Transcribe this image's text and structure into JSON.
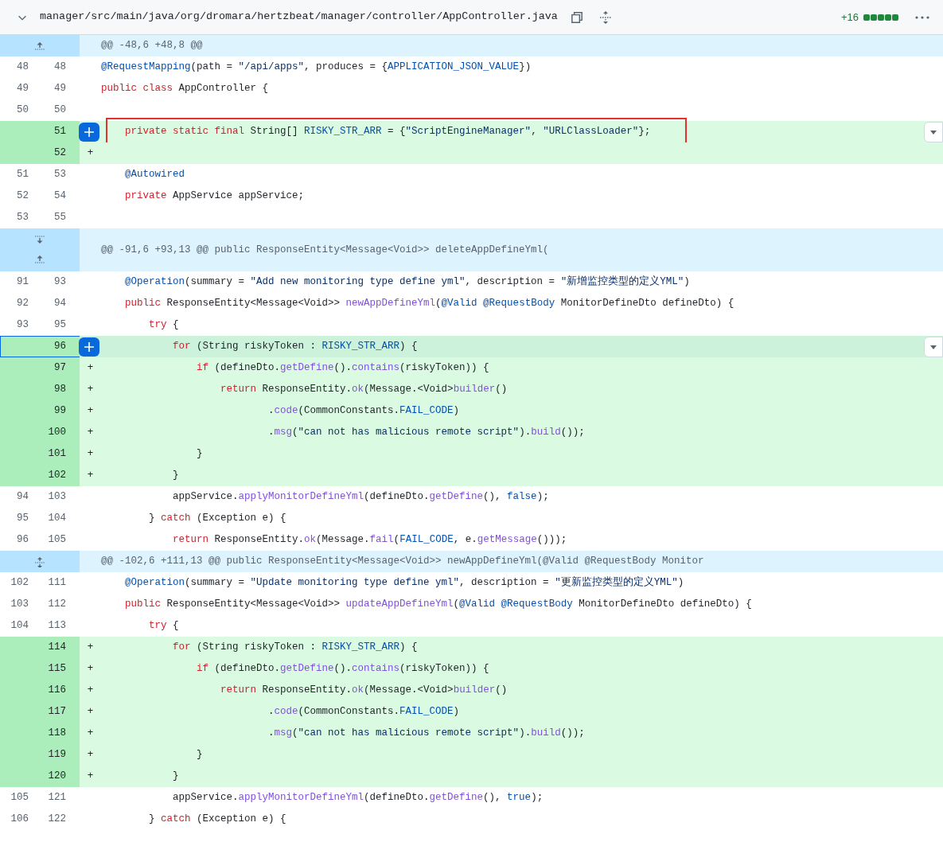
{
  "file_header": {
    "expanded": true,
    "path": "manager/src/main/java/org/dromara/hertzbeat/manager/controller/AppController.java",
    "diffstat": {
      "text": "+16",
      "blocks": [
        {
          "kind": "added"
        },
        {
          "kind": "added"
        },
        {
          "kind": "added"
        },
        {
          "kind": "added"
        },
        {
          "kind": "added"
        }
      ]
    }
  },
  "rows": [
    {
      "kind": "hunk",
      "buttons": [
        {
          "kind": "up"
        }
      ],
      "text": "@@ -48,6 +48,8 @@"
    },
    {
      "kind": "context",
      "old": "48",
      "new": "48",
      "selected": false,
      "code": [
        {
          "kind": "annotation",
          "text": "@RequestMapping"
        },
        {
          "kind": "plain",
          "text": "(path = "
        },
        {
          "kind": "string",
          "text": "\"/api/apps\""
        },
        {
          "kind": "plain",
          "text": ", produces = {"
        },
        {
          "kind": "constant",
          "text": "APPLICATION_JSON_VALUE"
        },
        {
          "kind": "plain",
          "text": "})"
        }
      ]
    },
    {
      "kind": "context",
      "old": "49",
      "new": "49",
      "selected": false,
      "code": [
        {
          "kind": "keyword",
          "text": "public class"
        },
        {
          "kind": "plain",
          "text": " AppController {"
        }
      ]
    },
    {
      "kind": "context",
      "old": "50",
      "new": "50",
      "selected": false,
      "code": []
    },
    {
      "kind": "added",
      "new": "51",
      "selected": false,
      "hovered": true,
      "boxed": true,
      "code": [
        {
          "kind": "keyword",
          "text": "    private static final"
        },
        {
          "kind": "plain",
          "text": " String[] "
        },
        {
          "kind": "constant",
          "text": "RISKY_STR_ARR"
        },
        {
          "kind": "plain",
          "text": " = {"
        },
        {
          "kind": "string",
          "text": "\"ScriptEngineManager\""
        },
        {
          "kind": "plain",
          "text": ", "
        },
        {
          "kind": "string",
          "text": "\"URLClassLoader\""
        },
        {
          "kind": "plain",
          "text": "};"
        }
      ]
    },
    {
      "kind": "added",
      "new": "52",
      "marker": "+",
      "selected": false,
      "code": []
    },
    {
      "kind": "context",
      "old": "51",
      "new": "53",
      "selected": false,
      "code": [
        {
          "kind": "annotation",
          "text": "    @Autowired"
        }
      ]
    },
    {
      "kind": "context",
      "old": "52",
      "new": "54",
      "selected": false,
      "code": [
        {
          "kind": "keyword",
          "text": "    private"
        },
        {
          "kind": "plain",
          "text": " AppService appService;"
        }
      ]
    },
    {
      "kind": "context",
      "old": "53",
      "new": "55",
      "selected": false,
      "code": []
    },
    {
      "kind": "hunk",
      "buttons": [
        {
          "kind": "down"
        },
        {
          "kind": "up"
        }
      ],
      "text": "@@ -91,6 +93,13 @@ public ResponseEntity<Message<Void>> deleteAppDefineYml("
    },
    {
      "kind": "context",
      "old": "91",
      "new": "93",
      "selected": false,
      "code": [
        {
          "kind": "annotation",
          "text": "    @Operation"
        },
        {
          "kind": "plain",
          "text": "(summary = "
        },
        {
          "kind": "string",
          "text": "\"Add new monitoring type define yml\""
        },
        {
          "kind": "plain",
          "text": ", description = "
        },
        {
          "kind": "string",
          "text": "\"新增监控类型的定义YML\""
        },
        {
          "kind": "plain",
          "text": ")"
        }
      ]
    },
    {
      "kind": "context",
      "old": "92",
      "new": "94",
      "selected": false,
      "code": [
        {
          "kind": "keyword",
          "text": "    public"
        },
        {
          "kind": "plain",
          "text": " ResponseEntity<Message<Void>> "
        },
        {
          "kind": "method",
          "text": "newAppDefineYml"
        },
        {
          "kind": "plain",
          "text": "("
        },
        {
          "kind": "annotation",
          "text": "@Valid @RequestBody"
        },
        {
          "kind": "plain",
          "text": " MonitorDefineDto defineDto) {"
        }
      ]
    },
    {
      "kind": "context",
      "old": "93",
      "new": "95",
      "selected": false,
      "code": [
        {
          "kind": "keyword",
          "text": "        try"
        },
        {
          "kind": "plain",
          "text": " {"
        }
      ]
    },
    {
      "kind": "added",
      "new": "96",
      "selected": true,
      "hovered": true,
      "code": [
        {
          "kind": "keyword",
          "text": "            for"
        },
        {
          "kind": "plain",
          "text": " (String riskyToken : "
        },
        {
          "kind": "constant",
          "text": "RISKY_STR_ARR"
        },
        {
          "kind": "plain",
          "text": ") {"
        }
      ]
    },
    {
      "kind": "added",
      "new": "97",
      "marker": "+",
      "selected": false,
      "code": [
        {
          "kind": "keyword",
          "text": "                if"
        },
        {
          "kind": "plain",
          "text": " (defineDto."
        },
        {
          "kind": "method",
          "text": "getDefine"
        },
        {
          "kind": "plain",
          "text": "()."
        },
        {
          "kind": "method",
          "text": "contains"
        },
        {
          "kind": "plain",
          "text": "(riskyToken)) {"
        }
      ]
    },
    {
      "kind": "added",
      "new": "98",
      "marker": "+",
      "selected": false,
      "code": [
        {
          "kind": "keyword",
          "text": "                    return"
        },
        {
          "kind": "plain",
          "text": " ResponseEntity."
        },
        {
          "kind": "method",
          "text": "ok"
        },
        {
          "kind": "plain",
          "text": "(Message.<Void>"
        },
        {
          "kind": "method",
          "text": "builder"
        },
        {
          "kind": "plain",
          "text": "()"
        }
      ]
    },
    {
      "kind": "added",
      "new": "99",
      "marker": "+",
      "selected": false,
      "code": [
        {
          "kind": "plain",
          "text": "                            ."
        },
        {
          "kind": "method",
          "text": "code"
        },
        {
          "kind": "plain",
          "text": "(CommonConstants."
        },
        {
          "kind": "constant",
          "text": "FAIL_CODE"
        },
        {
          "kind": "plain",
          "text": ")"
        }
      ]
    },
    {
      "kind": "added",
      "new": "100",
      "marker": "+",
      "selected": false,
      "code": [
        {
          "kind": "plain",
          "text": "                            ."
        },
        {
          "kind": "method",
          "text": "msg"
        },
        {
          "kind": "plain",
          "text": "("
        },
        {
          "kind": "string",
          "text": "\"can not has malicious remote script\""
        },
        {
          "kind": "plain",
          "text": ")."
        },
        {
          "kind": "method",
          "text": "build"
        },
        {
          "kind": "plain",
          "text": "());"
        }
      ]
    },
    {
      "kind": "added",
      "new": "101",
      "marker": "+",
      "selected": false,
      "code": [
        {
          "kind": "plain",
          "text": "                }"
        }
      ]
    },
    {
      "kind": "added",
      "new": "102",
      "marker": "+",
      "selected": false,
      "code": [
        {
          "kind": "plain",
          "text": "            }"
        }
      ]
    },
    {
      "kind": "context",
      "old": "94",
      "new": "103",
      "selected": false,
      "code": [
        {
          "kind": "plain",
          "text": "            appService."
        },
        {
          "kind": "method",
          "text": "applyMonitorDefineYml"
        },
        {
          "kind": "plain",
          "text": "(defineDto."
        },
        {
          "kind": "method",
          "text": "getDefine"
        },
        {
          "kind": "plain",
          "text": "(), "
        },
        {
          "kind": "constant",
          "text": "false"
        },
        {
          "kind": "plain",
          "text": ");"
        }
      ]
    },
    {
      "kind": "context",
      "old": "95",
      "new": "104",
      "selected": false,
      "code": [
        {
          "kind": "plain",
          "text": "        } "
        },
        {
          "kind": "keyword",
          "text": "catch"
        },
        {
          "kind": "plain",
          "text": " (Exception e) {"
        }
      ]
    },
    {
      "kind": "context",
      "old": "96",
      "new": "105",
      "selected": false,
      "code": [
        {
          "kind": "keyword",
          "text": "            return"
        },
        {
          "kind": "plain",
          "text": " ResponseEntity."
        },
        {
          "kind": "method",
          "text": "ok"
        },
        {
          "kind": "plain",
          "text": "(Message."
        },
        {
          "kind": "method",
          "text": "fail"
        },
        {
          "kind": "plain",
          "text": "("
        },
        {
          "kind": "constant",
          "text": "FAIL_CODE"
        },
        {
          "kind": "plain",
          "text": ", e."
        },
        {
          "kind": "method",
          "text": "getMessage"
        },
        {
          "kind": "plain",
          "text": "()));"
        }
      ]
    },
    {
      "kind": "hunk",
      "buttons": [
        {
          "kind": "both"
        }
      ],
      "text": "@@ -102,6 +111,13 @@ public ResponseEntity<Message<Void>> newAppDefineYml(@Valid @RequestBody Monitor"
    },
    {
      "kind": "context",
      "old": "102",
      "new": "111",
      "selected": false,
      "code": [
        {
          "kind": "annotation",
          "text": "    @Operation"
        },
        {
          "kind": "plain",
          "text": "(summary = "
        },
        {
          "kind": "string",
          "text": "\"Update monitoring type define yml\""
        },
        {
          "kind": "plain",
          "text": ", description = "
        },
        {
          "kind": "string",
          "text": "\"更新监控类型的定义YML\""
        },
        {
          "kind": "plain",
          "text": ")"
        }
      ]
    },
    {
      "kind": "context",
      "old": "103",
      "new": "112",
      "selected": false,
      "code": [
        {
          "kind": "keyword",
          "text": "    public"
        },
        {
          "kind": "plain",
          "text": " ResponseEntity<Message<Void>> "
        },
        {
          "kind": "method",
          "text": "updateAppDefineYml"
        },
        {
          "kind": "plain",
          "text": "("
        },
        {
          "kind": "annotation",
          "text": "@Valid @RequestBody"
        },
        {
          "kind": "plain",
          "text": " MonitorDefineDto defineDto) {"
        }
      ]
    },
    {
      "kind": "context",
      "old": "104",
      "new": "113",
      "selected": false,
      "code": [
        {
          "kind": "keyword",
          "text": "        try"
        },
        {
          "kind": "plain",
          "text": " {"
        }
      ]
    },
    {
      "kind": "added",
      "new": "114",
      "marker": "+",
      "selected": false,
      "code": [
        {
          "kind": "keyword",
          "text": "            for"
        },
        {
          "kind": "plain",
          "text": " (String riskyToken : "
        },
        {
          "kind": "constant",
          "text": "RISKY_STR_ARR"
        },
        {
          "kind": "plain",
          "text": ") {"
        }
      ]
    },
    {
      "kind": "added",
      "new": "115",
      "marker": "+",
      "selected": false,
      "code": [
        {
          "kind": "keyword",
          "text": "                if"
        },
        {
          "kind": "plain",
          "text": " (defineDto."
        },
        {
          "kind": "method",
          "text": "getDefine"
        },
        {
          "kind": "plain",
          "text": "()."
        },
        {
          "kind": "method",
          "text": "contains"
        },
        {
          "kind": "plain",
          "text": "(riskyToken)) {"
        }
      ]
    },
    {
      "kind": "added",
      "new": "116",
      "marker": "+",
      "selected": false,
      "code": [
        {
          "kind": "keyword",
          "text": "                    return"
        },
        {
          "kind": "plain",
          "text": " ResponseEntity."
        },
        {
          "kind": "method",
          "text": "ok"
        },
        {
          "kind": "plain",
          "text": "(Message.<Void>"
        },
        {
          "kind": "method",
          "text": "builder"
        },
        {
          "kind": "plain",
          "text": "()"
        }
      ]
    },
    {
      "kind": "added",
      "new": "117",
      "marker": "+",
      "selected": false,
      "code": [
        {
          "kind": "plain",
          "text": "                            ."
        },
        {
          "kind": "method",
          "text": "code"
        },
        {
          "kind": "plain",
          "text": "(CommonConstants."
        },
        {
          "kind": "constant",
          "text": "FAIL_CODE"
        },
        {
          "kind": "plain",
          "text": ")"
        }
      ]
    },
    {
      "kind": "added",
      "new": "118",
      "marker": "+",
      "selected": false,
      "code": [
        {
          "kind": "plain",
          "text": "                            ."
        },
        {
          "kind": "method",
          "text": "msg"
        },
        {
          "kind": "plain",
          "text": "("
        },
        {
          "kind": "string",
          "text": "\"can not has malicious remote script\""
        },
        {
          "kind": "plain",
          "text": ")."
        },
        {
          "kind": "method",
          "text": "build"
        },
        {
          "kind": "plain",
          "text": "());"
        }
      ]
    },
    {
      "kind": "added",
      "new": "119",
      "marker": "+",
      "selected": false,
      "code": [
        {
          "kind": "plain",
          "text": "                }"
        }
      ]
    },
    {
      "kind": "added",
      "new": "120",
      "marker": "+",
      "selected": false,
      "code": [
        {
          "kind": "plain",
          "text": "            }"
        }
      ]
    },
    {
      "kind": "context",
      "old": "105",
      "new": "121",
      "selected": false,
      "code": [
        {
          "kind": "plain",
          "text": "            appService."
        },
        {
          "kind": "method",
          "text": "applyMonitorDefineYml"
        },
        {
          "kind": "plain",
          "text": "(defineDto."
        },
        {
          "kind": "method",
          "text": "getDefine"
        },
        {
          "kind": "plain",
          "text": "(), "
        },
        {
          "kind": "constant",
          "text": "true"
        },
        {
          "kind": "plain",
          "text": ");"
        }
      ]
    },
    {
      "kind": "context",
      "old": "106",
      "new": "122",
      "selected": false,
      "code": [
        {
          "kind": "plain",
          "text": "        } "
        },
        {
          "kind": "keyword",
          "text": "catch"
        },
        {
          "kind": "plain",
          "text": " (Exception e) {"
        }
      ]
    }
  ]
}
